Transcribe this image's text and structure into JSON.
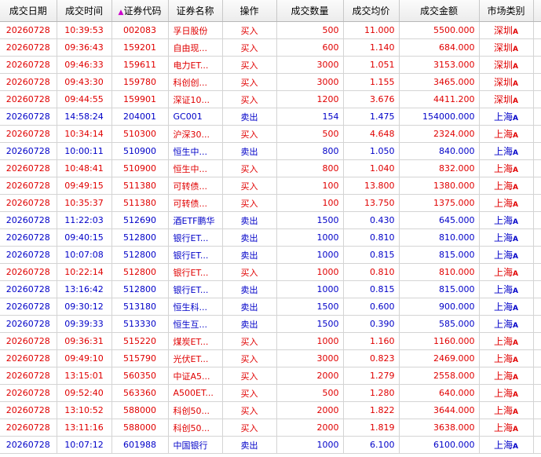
{
  "columns": {
    "date": "成交日期",
    "time": "成交时间",
    "code": "证券代码",
    "name": "证券名称",
    "action": "操作",
    "qty": "成交数量",
    "price": "成交均价",
    "amount": "成交金额",
    "market": "市场类别"
  },
  "sort_indicator": "▲",
  "colors": {
    "buy": "#e00000",
    "sell": "#0000c8"
  },
  "rows": [
    {
      "date": "20260728",
      "time": "10:39:53",
      "code": "002083",
      "name": "孚日股份",
      "action": "买入",
      "side": "buy",
      "qty": "500",
      "price": "11.000",
      "amount": "5500.000",
      "market": "深圳",
      "mark": "A"
    },
    {
      "date": "20260728",
      "time": "09:36:43",
      "code": "159201",
      "name": "自由现...",
      "action": "买入",
      "side": "buy",
      "qty": "600",
      "price": "1.140",
      "amount": "684.000",
      "market": "深圳",
      "mark": "A"
    },
    {
      "date": "20260728",
      "time": "09:46:33",
      "code": "159611",
      "name": "电力ET...",
      "action": "买入",
      "side": "buy",
      "qty": "3000",
      "price": "1.051",
      "amount": "3153.000",
      "market": "深圳",
      "mark": "A"
    },
    {
      "date": "20260728",
      "time": "09:43:30",
      "code": "159780",
      "name": "科创创...",
      "action": "买入",
      "side": "buy",
      "qty": "3000",
      "price": "1.155",
      "amount": "3465.000",
      "market": "深圳",
      "mark": "A"
    },
    {
      "date": "20260728",
      "time": "09:44:55",
      "code": "159901",
      "name": "深证10...",
      "action": "买入",
      "side": "buy",
      "qty": "1200",
      "price": "3.676",
      "amount": "4411.200",
      "market": "深圳",
      "mark": "A"
    },
    {
      "date": "20260728",
      "time": "14:58:24",
      "code": "204001",
      "name": "GC001",
      "action": "卖出",
      "side": "sell",
      "qty": "154",
      "price": "1.475",
      "amount": "154000.000",
      "market": "上海",
      "mark": "A"
    },
    {
      "date": "20260728",
      "time": "10:34:14",
      "code": "510300",
      "name": "沪深30...",
      "action": "买入",
      "side": "buy",
      "qty": "500",
      "price": "4.648",
      "amount": "2324.000",
      "market": "上海",
      "mark": "A"
    },
    {
      "date": "20260728",
      "time": "10:00:11",
      "code": "510900",
      "name": "恒生中...",
      "action": "卖出",
      "side": "sell",
      "qty": "800",
      "price": "1.050",
      "amount": "840.000",
      "market": "上海",
      "mark": "A"
    },
    {
      "date": "20260728",
      "time": "10:48:41",
      "code": "510900",
      "name": "恒生中...",
      "action": "买入",
      "side": "buy",
      "qty": "800",
      "price": "1.040",
      "amount": "832.000",
      "market": "上海",
      "mark": "A"
    },
    {
      "date": "20260728",
      "time": "09:49:15",
      "code": "511380",
      "name": "可转债...",
      "action": "买入",
      "side": "buy",
      "qty": "100",
      "price": "13.800",
      "amount": "1380.000",
      "market": "上海",
      "mark": "A"
    },
    {
      "date": "20260728",
      "time": "10:35:37",
      "code": "511380",
      "name": "可转债...",
      "action": "买入",
      "side": "buy",
      "qty": "100",
      "price": "13.750",
      "amount": "1375.000",
      "market": "上海",
      "mark": "A"
    },
    {
      "date": "20260728",
      "time": "11:22:03",
      "code": "512690",
      "name": "酒ETF鹏华",
      "action": "卖出",
      "side": "sell",
      "qty": "1500",
      "price": "0.430",
      "amount": "645.000",
      "market": "上海",
      "mark": "A"
    },
    {
      "date": "20260728",
      "time": "09:40:15",
      "code": "512800",
      "name": "银行ET...",
      "action": "卖出",
      "side": "sell",
      "qty": "1000",
      "price": "0.810",
      "amount": "810.000",
      "market": "上海",
      "mark": "A"
    },
    {
      "date": "20260728",
      "time": "10:07:08",
      "code": "512800",
      "name": "银行ET...",
      "action": "卖出",
      "side": "sell",
      "qty": "1000",
      "price": "0.815",
      "amount": "815.000",
      "market": "上海",
      "mark": "A"
    },
    {
      "date": "20260728",
      "time": "10:22:14",
      "code": "512800",
      "name": "银行ET...",
      "action": "买入",
      "side": "buy",
      "qty": "1000",
      "price": "0.810",
      "amount": "810.000",
      "market": "上海",
      "mark": "A"
    },
    {
      "date": "20260728",
      "time": "13:16:42",
      "code": "512800",
      "name": "银行ET...",
      "action": "卖出",
      "side": "sell",
      "qty": "1000",
      "price": "0.815",
      "amount": "815.000",
      "market": "上海",
      "mark": "A"
    },
    {
      "date": "20260728",
      "time": "09:30:12",
      "code": "513180",
      "name": "恒生科...",
      "action": "卖出",
      "side": "sell",
      "qty": "1500",
      "price": "0.600",
      "amount": "900.000",
      "market": "上海",
      "mark": "A"
    },
    {
      "date": "20260728",
      "time": "09:39:33",
      "code": "513330",
      "name": "恒生互...",
      "action": "卖出",
      "side": "sell",
      "qty": "1500",
      "price": "0.390",
      "amount": "585.000",
      "market": "上海",
      "mark": "A"
    },
    {
      "date": "20260728",
      "time": "09:36:31",
      "code": "515220",
      "name": "煤炭ET...",
      "action": "买入",
      "side": "buy",
      "qty": "1000",
      "price": "1.160",
      "amount": "1160.000",
      "market": "上海",
      "mark": "A"
    },
    {
      "date": "20260728",
      "time": "09:49:10",
      "code": "515790",
      "name": "光伏ET...",
      "action": "买入",
      "side": "buy",
      "qty": "3000",
      "price": "0.823",
      "amount": "2469.000",
      "market": "上海",
      "mark": "A"
    },
    {
      "date": "20260728",
      "time": "13:15:01",
      "code": "560350",
      "name": "中证A5...",
      "action": "买入",
      "side": "buy",
      "qty": "2000",
      "price": "1.279",
      "amount": "2558.000",
      "market": "上海",
      "mark": "A"
    },
    {
      "date": "20260728",
      "time": "09:52:40",
      "code": "563360",
      "name": "A500ET...",
      "action": "买入",
      "side": "buy",
      "qty": "500",
      "price": "1.280",
      "amount": "640.000",
      "market": "上海",
      "mark": "A"
    },
    {
      "date": "20260728",
      "time": "13:10:52",
      "code": "588000",
      "name": "科创50...",
      "action": "买入",
      "side": "buy",
      "qty": "2000",
      "price": "1.822",
      "amount": "3644.000",
      "market": "上海",
      "mark": "A"
    },
    {
      "date": "20260728",
      "time": "13:11:16",
      "code": "588000",
      "name": "科创50...",
      "action": "买入",
      "side": "buy",
      "qty": "2000",
      "price": "1.819",
      "amount": "3638.000",
      "market": "上海",
      "mark": "A"
    },
    {
      "date": "20260728",
      "time": "10:07:12",
      "code": "601988",
      "name": "中国银行",
      "action": "卖出",
      "side": "sell",
      "qty": "1000",
      "price": "6.100",
      "amount": "6100.000",
      "market": "上海",
      "mark": "A"
    }
  ]
}
